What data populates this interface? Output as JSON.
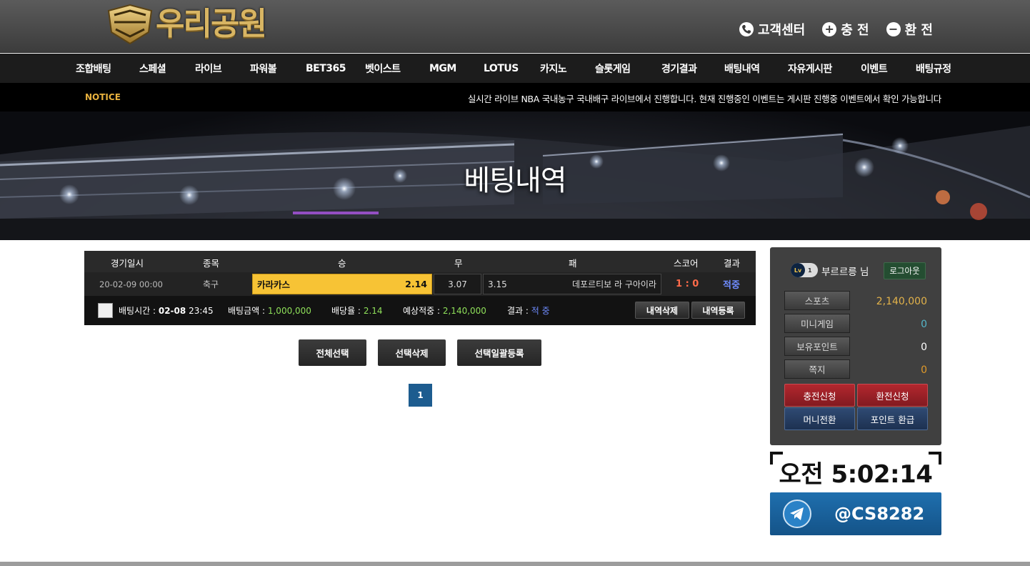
{
  "header": {
    "logo_text": "우리공원",
    "links": [
      {
        "label": "고객센터",
        "icon": "phone-icon"
      },
      {
        "label": "충 전",
        "icon": "plus-circle-icon"
      },
      {
        "label": "환 전",
        "icon": "minus-circle-icon"
      }
    ]
  },
  "nav": {
    "items": [
      "조합배팅",
      "스페셜",
      "라이브",
      "파워볼",
      "BET365",
      "벳이스트",
      "MGM",
      "LOTUS",
      "카지노",
      "슬롯게임",
      "경기결과",
      "배팅내역",
      "자유게시판",
      "이벤트",
      "배팅규정"
    ]
  },
  "notice": {
    "label": "NOTICE",
    "text": "실시간 라이브 NBA 국내농구 국내배구 라이브에서 진행합니다. 현재 진행중인 이벤트는 게시판 진행중 이벤트에서 확인 가능합니다"
  },
  "banner": {
    "title": "베팅내역"
  },
  "bet_table": {
    "headers": [
      "경기일시",
      "종목",
      "승",
      "무",
      "패",
      "스코어",
      "결과"
    ],
    "row": {
      "datetime": "20-02-09 00:00",
      "sport": "축구",
      "home_team": "카라카스",
      "home_odds": "2.14",
      "draw_odds": "3.07",
      "away_odds": "3.15",
      "away_team": "데포르티보 라 구아이라",
      "score": "1 : 0",
      "result": "적중"
    },
    "footer": {
      "bet_time_label": "배팅시간 :",
      "bet_date": "02-08",
      "bet_time": "23:45",
      "amount_label": "배팅금액 :",
      "amount": "1,000,000",
      "rate_label": "배당율 :",
      "rate": "2.14",
      "expected_label": "예상적중 :",
      "expected": "2,140,000",
      "result_label": "결과 :",
      "result": "적 중",
      "delete_label": "내역삭제",
      "register_label": "내역등록"
    }
  },
  "actions": {
    "select_all": "전체선택",
    "delete_selected": "선택삭제",
    "bulk_register": "선택일괄등록"
  },
  "pagination": {
    "current": "1"
  },
  "user_panel": {
    "level_badge": "Lv",
    "level": "1",
    "username": "부르르릉 님",
    "logout": "로그아웃",
    "rows": [
      {
        "label": "스포츠",
        "value": "2,140,000",
        "color": "#e2b24a"
      },
      {
        "label": "미니게임",
        "value": "0",
        "color": "#55b6c9"
      },
      {
        "label": "보유포인트",
        "value": "0",
        "color": "#ffffff"
      },
      {
        "label": "쪽지",
        "value": "0",
        "color": "#e09a2a"
      }
    ],
    "buttons": {
      "deposit": "충전신청",
      "withdraw": "환전신청",
      "money_convert": "머니전환",
      "point_exchange": "포인트 환급"
    }
  },
  "clock": {
    "time": "오전 5:02:14"
  },
  "telegram": {
    "handle": "@CS8282",
    "icon": "telegram-icon"
  },
  "colors": {
    "accent_gold": "#f7c335",
    "nav_bg": "#1c1c1c",
    "win_score": "#ff6b4a",
    "result_blue": "#6f8cff",
    "green_value": "#8fe05a",
    "telegram_blue": "#1a64a0"
  }
}
